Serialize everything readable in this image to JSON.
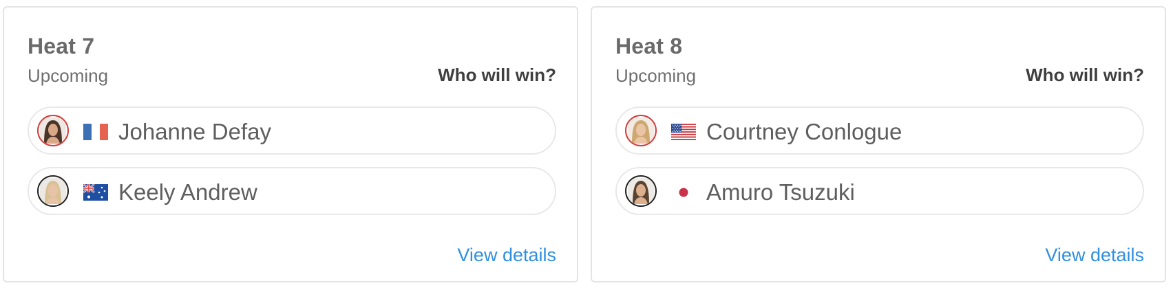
{
  "heats": [
    {
      "title": "Heat 7",
      "status": "Upcoming",
      "question": "Who will win?",
      "details_label": "View details",
      "athletes": [
        {
          "name": "Johanne Defay",
          "flag": "france-flag-icon",
          "avatar_ring": "#d33a3a"
        },
        {
          "name": "Keely Andrew",
          "flag": "australia-flag-icon",
          "avatar_ring": "#222222"
        }
      ]
    },
    {
      "title": "Heat 8",
      "status": "Upcoming",
      "question": "Who will win?",
      "details_label": "View details",
      "athletes": [
        {
          "name": "Courtney Conlogue",
          "flag": "usa-flag-icon",
          "avatar_ring": "#d33a3a"
        },
        {
          "name": "Amuro Tsuzuki",
          "flag": "japan-flag-icon",
          "avatar_ring": "#222222"
        }
      ]
    }
  ],
  "colors": {
    "link": "#2f8fe0",
    "border": "#e4e4e4",
    "title": "#6a6a6a"
  }
}
